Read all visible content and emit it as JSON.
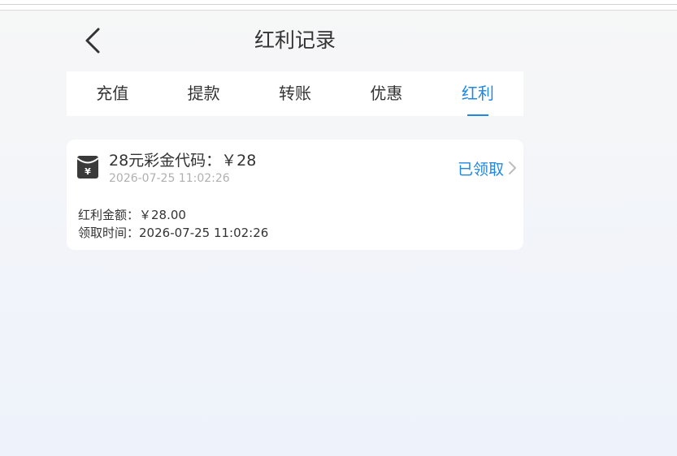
{
  "header": {
    "title": "红利记录",
    "back_icon": "chevron-left-icon"
  },
  "tabs": [
    {
      "label": "充值",
      "active": false
    },
    {
      "label": "提款",
      "active": false
    },
    {
      "label": "转账",
      "active": false
    },
    {
      "label": "优惠",
      "active": false
    },
    {
      "label": "红利",
      "active": true
    }
  ],
  "records": [
    {
      "icon": "red-envelope-icon",
      "title": "28元彩金代码：￥28",
      "time": "2026-07-25 11:02:26",
      "status": "已领取",
      "amount_label": "红利金额：",
      "amount": "￥28.00",
      "claim_time_label": "领取时间：",
      "claim_time": "2026-07-25 11:02:26"
    }
  ],
  "colors": {
    "accent": "#1e88e5",
    "text": "#333333",
    "muted": "#b0b0b0"
  }
}
